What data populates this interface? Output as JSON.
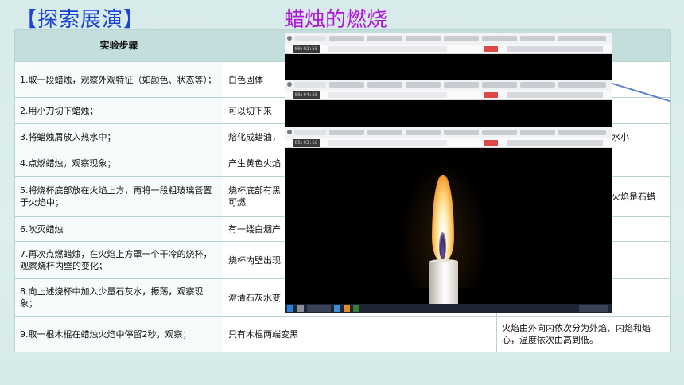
{
  "header": {
    "section_title": "【探索展演】",
    "topic_title": "蜡烛的燃烧"
  },
  "table": {
    "col_header_steps": "实验步骤",
    "rows": [
      {
        "step": "1.取一段蜡烛，观察外观特征（如颜色、状态等）；",
        "phenomenon": "白色固体",
        "conclusion": ""
      },
      {
        "step": "2.用小刀切下蜡烛；",
        "phenomenon": "可以切下来",
        "conclusion": ""
      },
      {
        "step": "3.将蜡烛屑放入热水中；",
        "phenomenon": "熔化成蜡油，",
        "conclusion": "水小"
      },
      {
        "step": "4.点燃蜡烛，观察现象；",
        "phenomenon": "产生黄色火焰",
        "conclusion": ""
      },
      {
        "step": "5.将烧杯底部放在火焰上方，再将一段粗玻璃管置于火焰中；",
        "phenomenon": "烧杯底部有黑",
        "phenomenon_2": "可燃",
        "conclusion": "火焰是石蜡"
      },
      {
        "step": "6.吹灭蜡烛",
        "phenomenon": "有一缕白烟产",
        "conclusion": ""
      },
      {
        "step": "7.再次点燃蜡烛，在火焰上方罩一个干冷的烧杯，观察烧杯内壁的变化；",
        "phenomenon": "烧杯内壁出现",
        "conclusion": ""
      },
      {
        "step": "8.向上述烧杯中加入少量石灰水，振荡，观察现象；",
        "phenomenon": "澄清石灰水变",
        "conclusion": ""
      },
      {
        "step": "9.取一根木棍在蜡烛火焰中停留2秒，观察；",
        "phenomenon": "只有木棍两端变黑",
        "conclusion": "火焰由外向内依次分为外焰、内焰和焰心，温度依次由高到低。"
      }
    ]
  },
  "video": {
    "timestamps": [
      "00:02:56",
      "00:04:56",
      "00:03:56"
    ]
  },
  "colors": {
    "section_title": "#1a44d6",
    "topic_title": "#b015e0",
    "header_bg": "#c4dede",
    "background": "#d9ecec"
  }
}
